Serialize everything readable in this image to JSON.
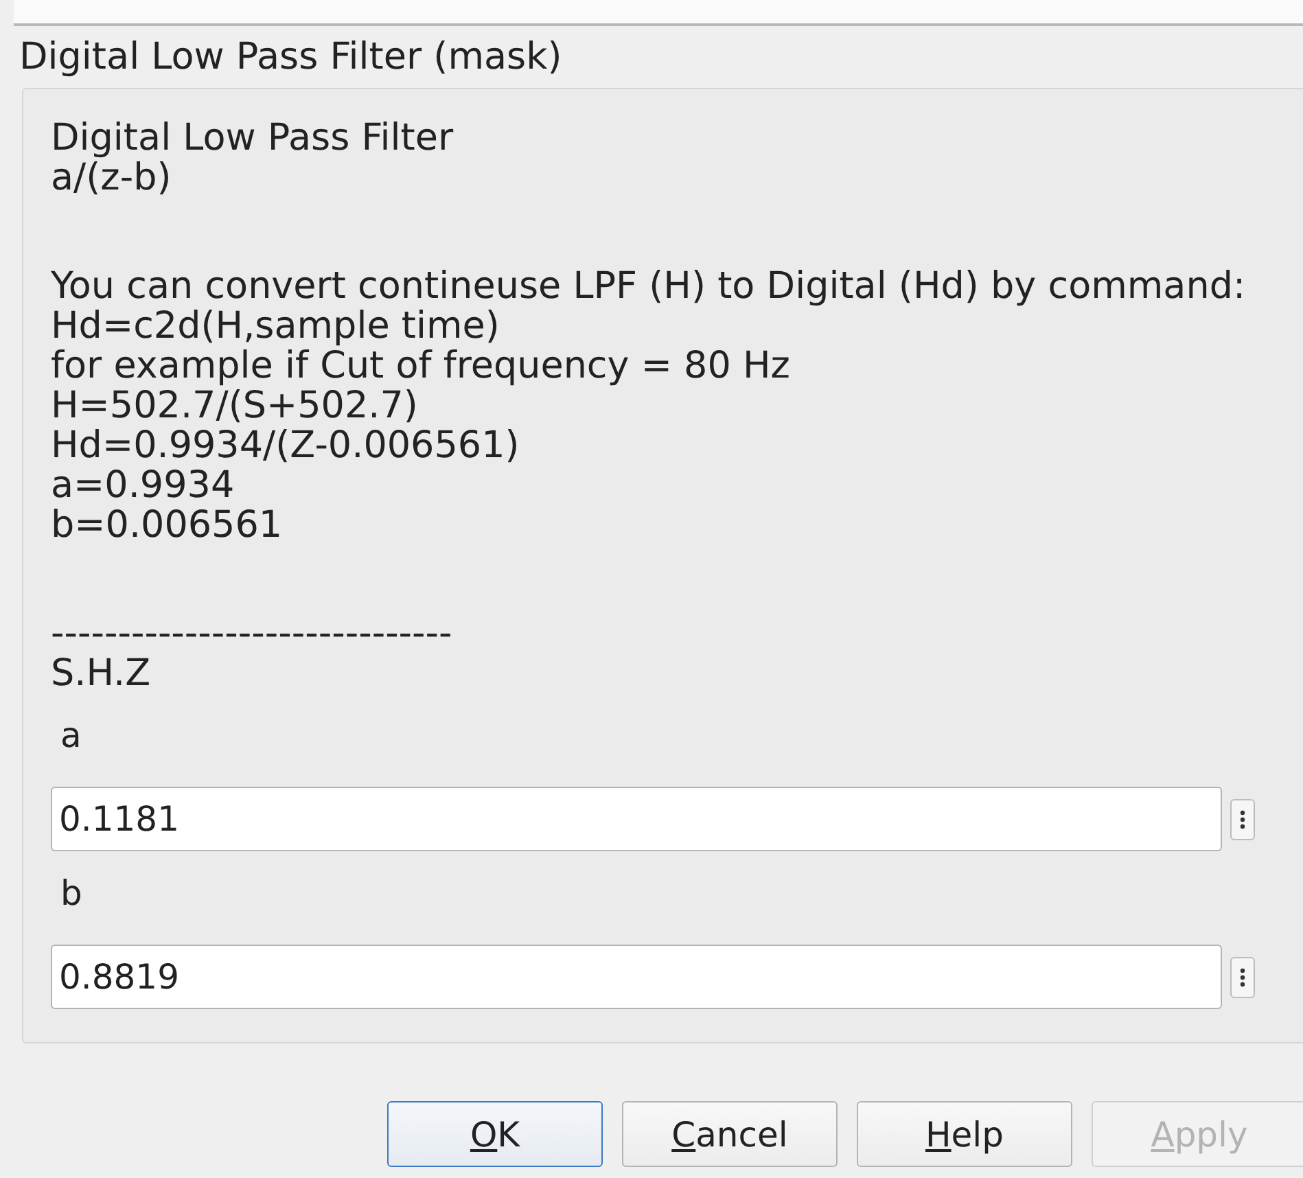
{
  "window": {
    "title": "Digital Low Pass Filter (mask)"
  },
  "description": [
    {
      "lines": [
        "Digital Low Pass Filter",
        "a/(z-b)"
      ]
    },
    {
      "lines": [
        "You can convert contineuse LPF (H) to Digital (Hd) by command:",
        "Hd=c2d(H,sample time)",
        "for example if Cut of frequency = 80 Hz",
        "H=502.7/(S+502.7)",
        "Hd=0.9934/(Z-0.006561)",
        "a=0.9934",
        "b=0.006561"
      ]
    },
    {
      "lines": [
        "------------------------------",
        "S.H.Z"
      ]
    }
  ],
  "parameters": [
    {
      "label": "a",
      "value": "0.1181"
    },
    {
      "label": "b",
      "value": "0.8819"
    }
  ],
  "buttons": [
    {
      "accel": "O",
      "rest": "K",
      "default": true,
      "disabled": false
    },
    {
      "accel": "C",
      "rest": "ancel",
      "default": false,
      "disabled": false
    },
    {
      "accel": "H",
      "rest": "elp",
      "default": false,
      "disabled": false
    },
    {
      "accel": "A",
      "rest": "pply",
      "default": false,
      "disabled": true
    }
  ]
}
